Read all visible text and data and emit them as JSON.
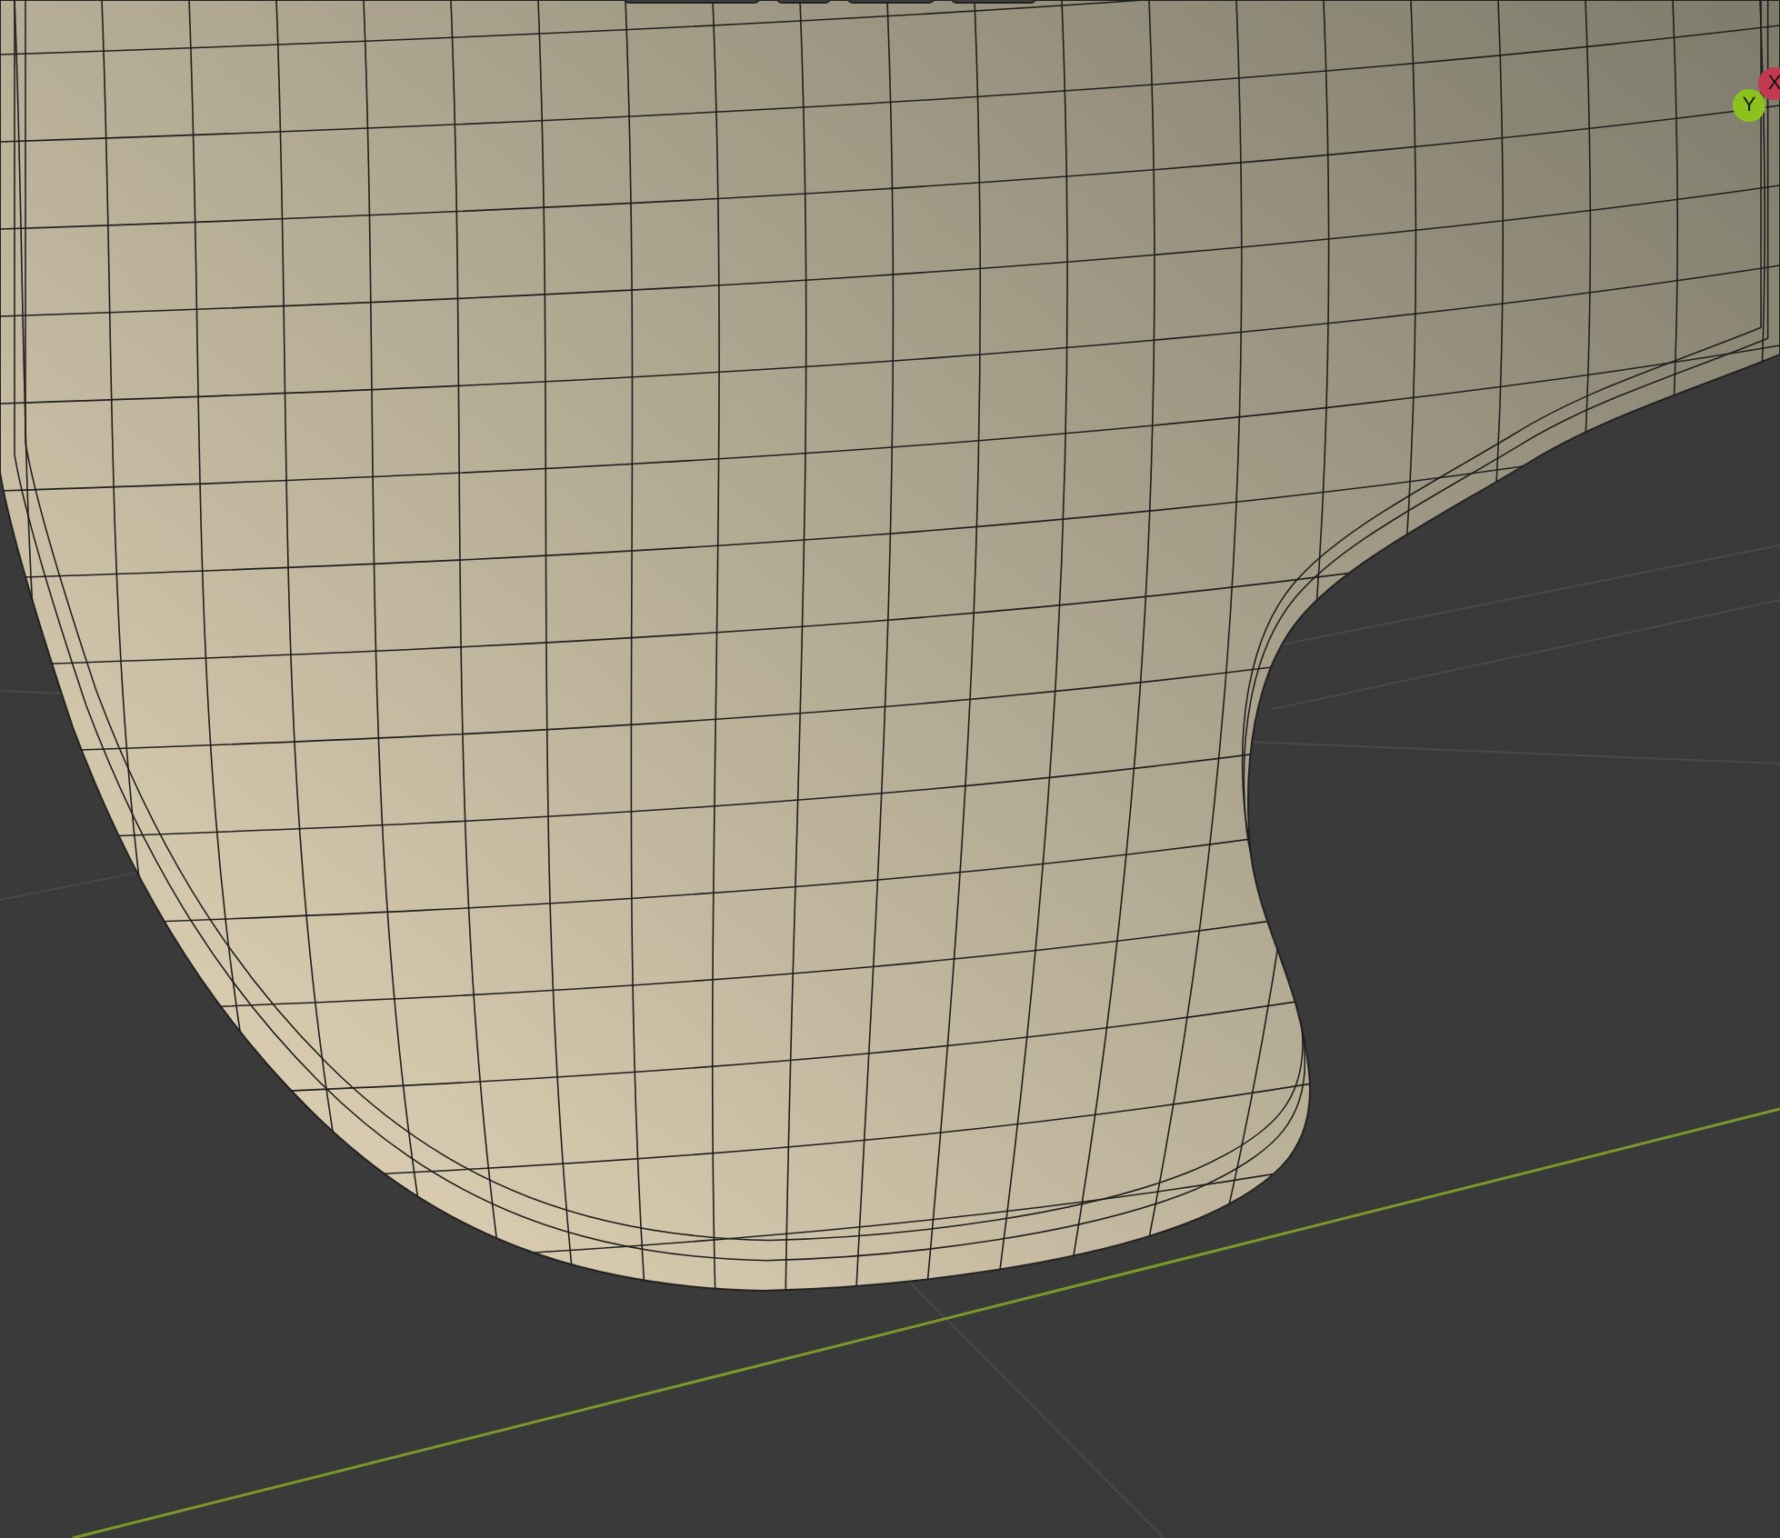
{
  "viewport": {
    "gizmo": [
      {
        "label": "X",
        "color": "#c23a52"
      },
      {
        "label": "Y",
        "color": "#8cc21e"
      }
    ]
  }
}
